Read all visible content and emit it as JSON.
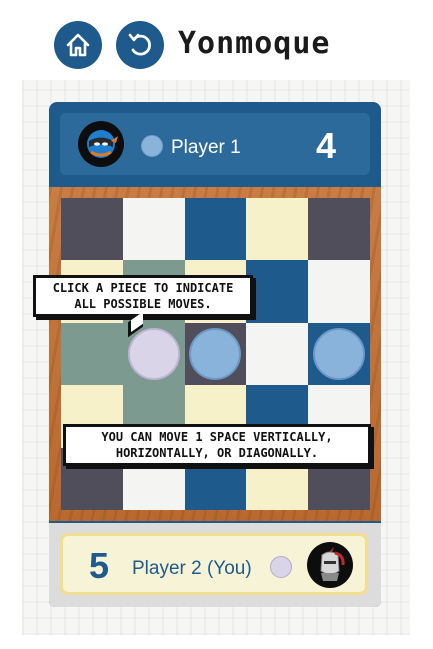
{
  "header": {
    "title": "Yonmoque",
    "home_icon": "home-icon",
    "undo_icon": "undo-icon"
  },
  "player1": {
    "name": "Player 1",
    "score": "4",
    "piece_color": "#8ab3dc",
    "avatar": "ninja-avatar-icon"
  },
  "player2": {
    "name": "Player 2 (You)",
    "score": "5",
    "piece_color": "#d9d4e8",
    "avatar": "knight-avatar-icon"
  },
  "board": {
    "rows": [
      [
        "dark",
        "white",
        "blue",
        "cream",
        "dark"
      ],
      [
        "cream",
        "sage",
        "cream",
        "blue",
        "white"
      ],
      [
        "sage",
        "sage",
        "dark",
        "white",
        "blue"
      ],
      [
        "cream",
        "sage",
        "cream",
        "blue",
        "white"
      ],
      [
        "dark",
        "white",
        "blue",
        "cream",
        "dark"
      ]
    ],
    "pieces": [
      {
        "row": 2,
        "col": 1,
        "color": "lavender"
      },
      {
        "row": 2,
        "col": 2,
        "color": "blue"
      },
      {
        "row": 2,
        "col": 4,
        "color": "blue"
      }
    ]
  },
  "tooltips": {
    "tip1_line1": "CLICK A PIECE TO INDICATE",
    "tip1_line2": "ALL POSSIBLE MOVES.",
    "tip2_line1": "YOU CAN MOVE 1 SPACE VERTICALLY,",
    "tip2_line2": "HORIZONTALLY, OR DIAGONALLY."
  },
  "colors": {
    "brand_blue": "#1e5a8c",
    "wood": "#c47a40",
    "dark_tile": "#4f4e5a",
    "cream_tile": "#f6f1c9",
    "sage_tile": "#7d9a90"
  }
}
